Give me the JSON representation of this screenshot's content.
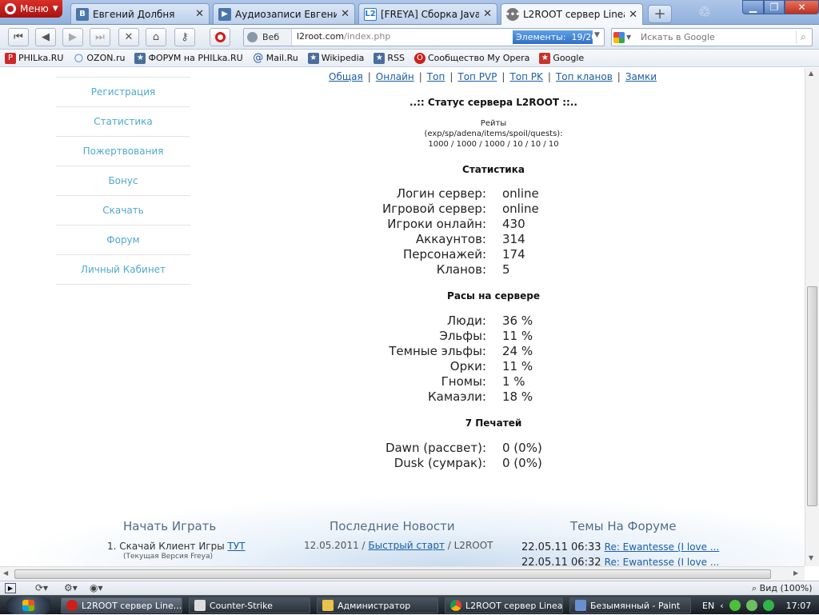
{
  "browser": {
    "menu_label": "Меню",
    "tabs": [
      {
        "title": "Евгений Долбня",
        "favicon": "vk-icon"
      },
      {
        "title": "Аудиозаписи Евгения ...",
        "favicon": "audio-icon"
      },
      {
        "title": "[FREYA] Сборка Java с...",
        "favicon": "l2-icon"
      },
      {
        "title": "L2ROOT сервер Lineage...",
        "favicon": "chat-bubble-icon",
        "active": true
      }
    ],
    "address": {
      "scheme_label": "Веб",
      "url_host": "l2root.com",
      "url_path": "/index.php",
      "elements_label": "Элементы:",
      "elements_count": "19/20"
    },
    "search_placeholder": "Искать в Google",
    "bookmarks": [
      {
        "label": "PHILka.RU",
        "icon": "philka-icon"
      },
      {
        "label": "OZON.ru",
        "icon": "ozon-icon"
      },
      {
        "label": "ФОРУМ на PHILka.RU",
        "icon": "bookmark-star-icon"
      },
      {
        "label": "Mail.Ru",
        "icon": "mail-at-icon"
      },
      {
        "label": "Wikipedia",
        "icon": "bookmark-star-icon"
      },
      {
        "label": "RSS",
        "icon": "bookmark-star-icon"
      },
      {
        "label": "Сообщество My Opera",
        "icon": "opera-icon"
      },
      {
        "label": "Google",
        "icon": "google-bookmark-icon"
      }
    ]
  },
  "sidebar": {
    "items": [
      "Регистрация",
      "Статистика",
      "Пожертвования",
      "Бонус",
      "Скачать",
      "Форум",
      "Личный Кабинет"
    ]
  },
  "topnav": [
    "Общая",
    "Онлайн",
    "Топ",
    "Топ PVP",
    "Топ PK",
    "Топ кланов",
    "Замки"
  ],
  "status": {
    "title": "..:: Статус сервера L2ROOT ::..",
    "rates_title": "Рейты",
    "rates_keys": "(exp/sp/adena/items/spoil/quests):",
    "rates_values": "1000 / 1000 / 1000 / 10 / 10 / 10",
    "stats_heading": "Статистика",
    "stats": [
      {
        "k": "Логин сервер:",
        "v": "online"
      },
      {
        "k": "Игровой сервер:",
        "v": "online"
      },
      {
        "k": "Игроки онлайн:",
        "v": "430"
      },
      {
        "k": "Аккаунтов:",
        "v": "314"
      },
      {
        "k": "Персонажей:",
        "v": "174"
      },
      {
        "k": "Кланов:",
        "v": "5"
      }
    ],
    "races_heading": "Расы на сервере",
    "races": [
      {
        "k": "Люди:",
        "v": "36 %"
      },
      {
        "k": "Эльфы:",
        "v": "11 %"
      },
      {
        "k": "Темные эльфы:",
        "v": "24 %"
      },
      {
        "k": "Орки:",
        "v": "11 %"
      },
      {
        "k": "Гномы:",
        "v": "1 %"
      },
      {
        "k": "Камаэли:",
        "v": "18 %"
      }
    ],
    "seals_heading": "7 Печатей",
    "seals": [
      {
        "k": "Dawn (рассвет):",
        "v": "0 (0%)"
      },
      {
        "k": "Dusk (сумрак):",
        "v": "0 (0%)"
      }
    ]
  },
  "footer": {
    "start_title": "Начать Играть",
    "start_item_text": "1. Скачай Клиент Игры",
    "start_item_link": "ТУТ",
    "start_item_note": "(Текущая Версия Freya)",
    "news_title": "Последние Новости",
    "news_date": "12.05.2011",
    "news_link": "Быстрый старт",
    "news_tail": "L2ROOT",
    "forum_title": "Темы На Форуме",
    "forum_items": [
      {
        "time": "22.05.11 06:33",
        "link": "Re: Ewantesse (I love ..."
      },
      {
        "time": "22.05.11 06:32",
        "link": "Re: Ewantesse (I love ..."
      }
    ]
  },
  "statusbar": {
    "zoom_label": "Вид (100%)"
  },
  "taskbar": {
    "tasks": [
      {
        "label": "L2ROOT сервер Line...",
        "icon": "opera-icon",
        "active": true
      },
      {
        "label": "Counter-Strike",
        "icon": "counter-strike-icon"
      },
      {
        "label": "Администратор",
        "icon": "folder-icon"
      },
      {
        "label": "L2ROOT сервер Linea...",
        "icon": "chrome-icon"
      },
      {
        "label": "Безымянный - Paint",
        "icon": "paint-icon"
      }
    ],
    "lang": "EN",
    "clock": "17:07"
  },
  "colors": {
    "sidebar_link": "#4fa9cf",
    "link": "#1b5fa6",
    "opera_red": "#cc1f1a"
  }
}
